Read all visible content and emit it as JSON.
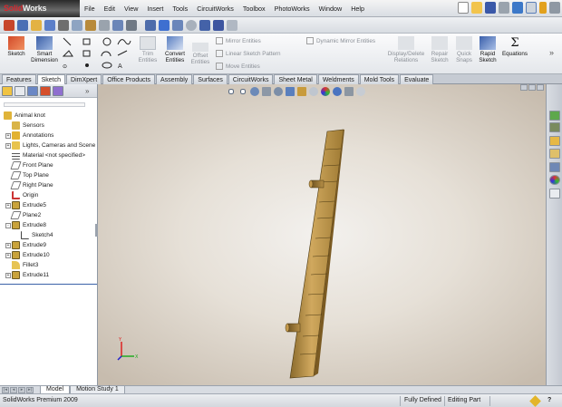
{
  "app": {
    "brand_solid": "Solid",
    "brand_works": "Works"
  },
  "menu": [
    "File",
    "Edit",
    "View",
    "Insert",
    "Tools",
    "CircuitWorks",
    "Toolbox",
    "PhotoWorks",
    "Window",
    "Help"
  ],
  "command_manager": {
    "sketch": "Sketch",
    "smart_dimension": "Smart Dimension",
    "trim_entities": "Trim Entities",
    "convert_entities": "Convert Entities",
    "offset_entities": "Offset Entities",
    "mirror_entities": "Mirror Entities",
    "linear_sketch_pattern": "Linear Sketch Pattern",
    "move_entities": "Move Entities",
    "dynamic_mirror": "Dynamic Mirror Entities",
    "display_delete_relations": "Display/Delete Relations",
    "repair_sketch": "Repair Sketch",
    "quick_snaps": "Quick Snaps",
    "rapid_sketch": "Rapid Sketch",
    "equations": "Equations"
  },
  "tabs": [
    "Features",
    "Sketch",
    "DimXpert",
    "Office Products",
    "Assembly",
    "Surfaces",
    "CircuitWorks",
    "Sheet Metal",
    "Weldments",
    "Mold Tools",
    "Evaluate"
  ],
  "active_tab": "Sketch",
  "tree": {
    "root": "Animal knot",
    "items": [
      {
        "label": "Sensors",
        "expand": ""
      },
      {
        "label": "Annotations",
        "expand": "+"
      },
      {
        "label": "Lights, Cameras and Scene",
        "expand": "+"
      },
      {
        "label": "Material <not specified>",
        "expand": ""
      },
      {
        "label": "Front Plane",
        "expand": ""
      },
      {
        "label": "Top Plane",
        "expand": ""
      },
      {
        "label": "Right Plane",
        "expand": ""
      },
      {
        "label": "Origin",
        "expand": ""
      },
      {
        "label": "Extrude5",
        "expand": "+"
      },
      {
        "label": "Plane2",
        "expand": ""
      },
      {
        "label": "Extrude8",
        "expand": "-"
      },
      {
        "label": "Sketch4",
        "expand": ""
      },
      {
        "label": "Extrude9",
        "expand": "+"
      },
      {
        "label": "Extrude10",
        "expand": "+"
      },
      {
        "label": "Fillet3",
        "expand": ""
      },
      {
        "label": "Extrude11",
        "expand": "+"
      }
    ]
  },
  "bottom_tabs": [
    "Model",
    "Motion Study 1"
  ],
  "status": {
    "product": "SolidWorks Premium 2009",
    "state": "Fully Defined",
    "mode": "Editing Part",
    "help": "?"
  },
  "colors": {
    "brand_red": "#d8272e",
    "part_wood": "#c9a35c",
    "tree_line": "#3b62a8"
  }
}
